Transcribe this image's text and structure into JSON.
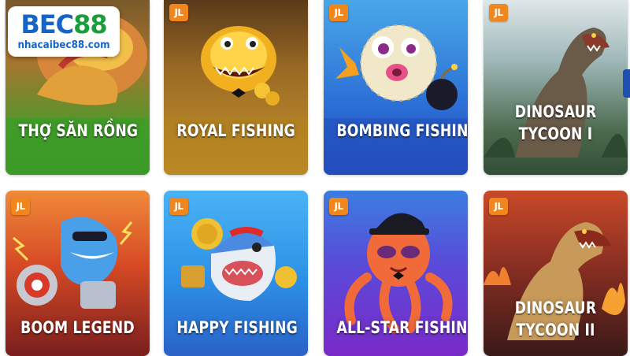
{
  "brand": {
    "name_prefix": "BEC",
    "name_suffix": "88",
    "url": "nhacaibec88.com"
  },
  "provider_badge": "JL",
  "games": [
    {
      "title": [
        "THỢ SĂN RỒNG"
      ],
      "art": "dragon-hunter-art"
    },
    {
      "title": [
        "ROYAL FISHING"
      ],
      "art": "golden-fish-art"
    },
    {
      "title": [
        "BOMBING FISHING"
      ],
      "art": "pufferfish-bomb-art"
    },
    {
      "title": [
        "DINOSAUR",
        "TYCOON I"
      ],
      "art": "dinosaur-art"
    },
    {
      "title": [
        "BOOM LEGEND"
      ],
      "art": "shark-robot-art"
    },
    {
      "title": [
        "HAPPY FISHING"
      ],
      "art": "happy-shark-art"
    },
    {
      "title": [
        "ALL-STAR FISHING"
      ],
      "art": "octopus-art"
    },
    {
      "title": [
        "DINOSAUR",
        "TYCOON II"
      ],
      "art": "fire-dinosaur-art"
    }
  ],
  "colors": {
    "badge": "#f0861c",
    "logo_blue": "#1565c8",
    "logo_green": "#1a9e3a"
  }
}
